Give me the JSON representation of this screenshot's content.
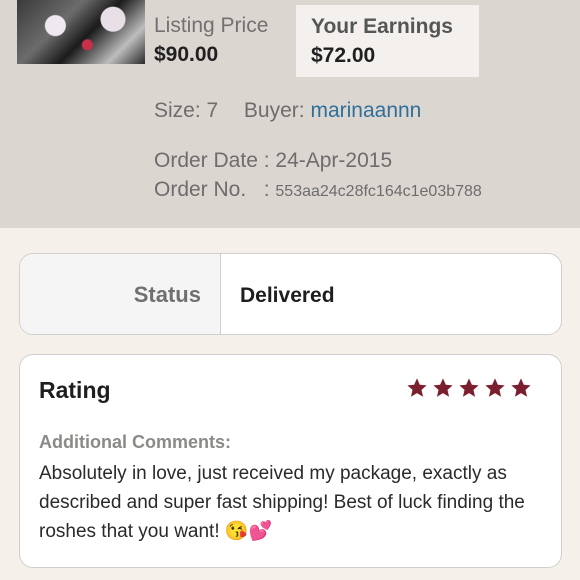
{
  "listing": {
    "price_label": "Listing Price",
    "price_value": "$90.00",
    "earnings_label": "Your Earnings",
    "earnings_value": "$72.00",
    "thumbnail": "product-photo"
  },
  "order": {
    "size_label": "Size:",
    "size_value": "7",
    "buyer_label": "Buyer:",
    "buyer_name": "marinaannn",
    "date_label": "Order Date",
    "date_value": "24-Apr-2015",
    "number_label": "Order No.",
    "number_value": "553aa24c28fc164c1e03b788"
  },
  "status": {
    "label": "Status",
    "value": "Delivered"
  },
  "rating": {
    "title": "Rating",
    "stars": 5,
    "star_color": "#7b1f2e",
    "comments_label": "Additional Comments:",
    "comments_text": "Absolutely in love, just received my package, exactly as described and super fast shipping! Best of luck finding the roshes that you want! 😘💕"
  },
  "colors": {
    "header_bg": "#dcd6d1",
    "page_bg": "#f5f1ea",
    "link": "#2f6f9a"
  }
}
